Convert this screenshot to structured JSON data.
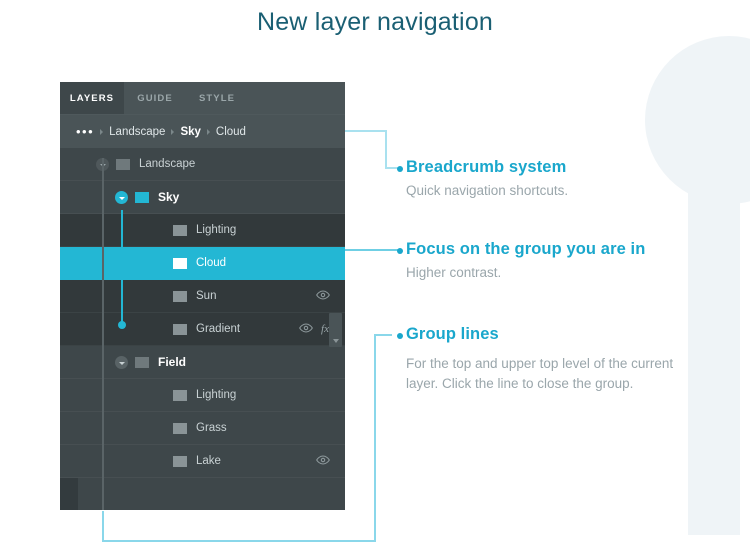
{
  "page": {
    "title": "New layer navigation",
    "title_color": "#1a5f73",
    "accent_color": "#23b7d4",
    "panel_bg": "#3e474a",
    "panel_focus_bg": "#32393b"
  },
  "panel": {
    "tabs": [
      {
        "label": "LAYERS",
        "active": true
      },
      {
        "label": "GUIDE",
        "active": false
      },
      {
        "label": "STYLE",
        "active": false
      }
    ],
    "breadcrumb": {
      "overflow": "•••",
      "items": [
        "Landscape",
        "Sky",
        "Cloud"
      ],
      "current": "Cloud"
    },
    "layers": [
      {
        "name": "Landscape",
        "depth": 0,
        "bold": false,
        "expanded": true,
        "chevron": "gray",
        "folder": "outline",
        "focused": false,
        "selected": false,
        "eye": false,
        "fx": false
      },
      {
        "name": "Sky",
        "depth": 1,
        "bold": true,
        "expanded": true,
        "chevron": "cyan",
        "folder": "cyan",
        "focused": false,
        "selected": false,
        "eye": false,
        "fx": false
      },
      {
        "name": "Lighting",
        "depth": 2,
        "bold": false,
        "expanded": false,
        "chevron": null,
        "folder": "gray",
        "focused": true,
        "selected": false,
        "eye": false,
        "fx": false
      },
      {
        "name": "Cloud",
        "depth": 2,
        "bold": false,
        "expanded": false,
        "chevron": null,
        "folder": "white",
        "focused": true,
        "selected": true,
        "eye": false,
        "fx": false
      },
      {
        "name": "Sun",
        "depth": 2,
        "bold": false,
        "expanded": false,
        "chevron": null,
        "folder": "gray",
        "focused": true,
        "selected": false,
        "eye": true,
        "fx": false
      },
      {
        "name": "Gradient",
        "depth": 2,
        "bold": false,
        "expanded": false,
        "chevron": null,
        "folder": "gray",
        "focused": true,
        "selected": false,
        "eye": true,
        "fx": true
      },
      {
        "name": "Field",
        "depth": 1,
        "bold": true,
        "expanded": true,
        "chevron": "gray2",
        "folder": "outline",
        "focused": false,
        "selected": false,
        "eye": false,
        "fx": false
      },
      {
        "name": "Lighting",
        "depth": 2,
        "bold": false,
        "expanded": false,
        "chevron": null,
        "folder": "gray",
        "focused": false,
        "selected": false,
        "eye": false,
        "fx": false
      },
      {
        "name": "Grass",
        "depth": 2,
        "bold": false,
        "expanded": false,
        "chevron": null,
        "folder": "gray",
        "focused": false,
        "selected": false,
        "eye": false,
        "fx": false
      },
      {
        "name": "Lake",
        "depth": 2,
        "bold": false,
        "expanded": false,
        "chevron": null,
        "folder": "gray",
        "focused": false,
        "selected": false,
        "eye": true,
        "fx": false
      }
    ],
    "fx_label": "fx"
  },
  "annotations": [
    {
      "title": "Breadcrumb system",
      "body": "Quick navigation shortcuts."
    },
    {
      "title": "Focus on the group you are in",
      "body": "Higher contrast."
    },
    {
      "title": "Group lines",
      "body": "For the top and upper top level of the current layer. Click the line to close the group."
    }
  ]
}
